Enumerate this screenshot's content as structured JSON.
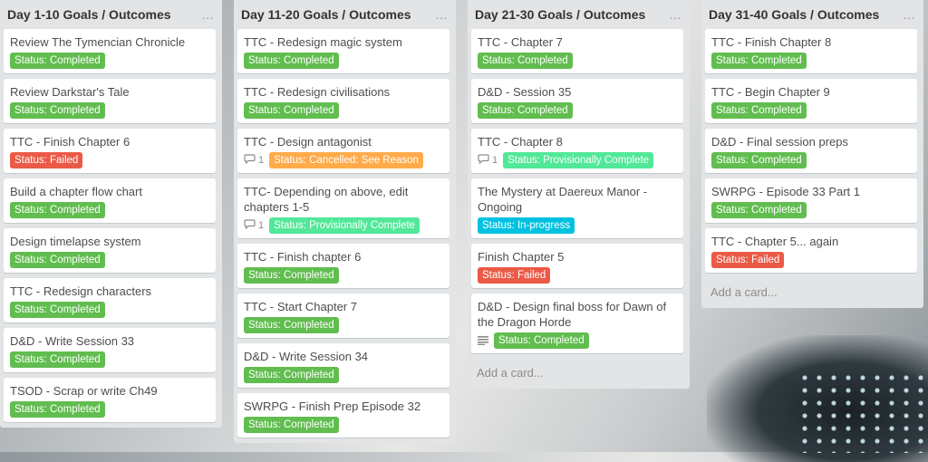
{
  "colors": {
    "completed": "#61bd4f",
    "failed": "#eb5a46",
    "cancelled": "#ffab4a",
    "provisional": "#51e898",
    "in_progress": "#00c2e0"
  },
  "lists": [
    {
      "title": "Day 1-10 Goals / Outcomes",
      "menu_icon": "ellipsis-icon",
      "cards": [
        {
          "title": "Review The Tymencian Chronicle",
          "label": "Status: Completed",
          "status": "completed"
        },
        {
          "title": "Review Darkstar's Tale",
          "label": "Status: Completed",
          "status": "completed"
        },
        {
          "title": "TTC - Finish Chapter 6",
          "label": "Status: Failed",
          "status": "failed"
        },
        {
          "title": "Build a chapter flow chart",
          "label": "Status: Completed",
          "status": "completed"
        },
        {
          "title": "Design timelapse system",
          "label": "Status: Completed",
          "status": "completed"
        },
        {
          "title": "TTC - Redesign characters",
          "label": "Status: Completed",
          "status": "completed"
        },
        {
          "title": "D&D - Write Session 33",
          "label": "Status: Completed",
          "status": "completed"
        },
        {
          "title": "TSOD - Scrap or write Ch49",
          "label": "Status: Completed",
          "status": "completed"
        }
      ]
    },
    {
      "title": "Day 11-20 Goals / Outcomes",
      "menu_icon": "ellipsis-icon",
      "cards": [
        {
          "title": "TTC - Redesign magic system",
          "label": "Status: Completed",
          "status": "completed"
        },
        {
          "title": "TTC - Redesign civilisations",
          "label": "Status: Completed",
          "status": "completed"
        },
        {
          "title": "TTC - Design antagonist",
          "comments": "1",
          "label": "Status: Cancelled: See Reason",
          "status": "cancelled"
        },
        {
          "title": "TTC- Depending on above, edit chapters 1-5",
          "comments": "1",
          "label": "Status: Provisionally Complete",
          "status": "provisional"
        },
        {
          "title": "TTC - Finish chapter 6",
          "label": "Status: Completed",
          "status": "completed"
        },
        {
          "title": "TTC - Start Chapter 7",
          "label": "Status: Completed",
          "status": "completed"
        },
        {
          "title": "D&D - Write Session 34",
          "label": "Status: Completed",
          "status": "completed"
        },
        {
          "title": "SWRPG - Finish Prep Episode 32",
          "label": "Status: Completed",
          "status": "completed"
        }
      ]
    },
    {
      "title": "Day 21-30 Goals / Outcomes",
      "menu_icon": "ellipsis-icon",
      "cards": [
        {
          "title": "TTC - Chapter 7",
          "label": "Status: Completed",
          "status": "completed"
        },
        {
          "title": "D&D - Session 35",
          "label": "Status: Completed",
          "status": "completed"
        },
        {
          "title": "TTC - Chapter 8",
          "comments": "1",
          "label": "Status: Provisionally Complete",
          "status": "provisional"
        },
        {
          "title": "The Mystery at Daereux Manor - Ongoing",
          "label": "Status: In-progress",
          "status": "in_progress"
        },
        {
          "title": "Finish Chapter 5",
          "label": "Status: Failed",
          "status": "failed"
        },
        {
          "title": "D&D - Design final boss for Dawn of the Dragon Horde",
          "description_icon": "description-icon",
          "label": "Status: Completed",
          "status": "completed"
        }
      ],
      "add_card": "Add a card..."
    },
    {
      "title": "Day 31-40 Goals / Outcomes",
      "menu_icon": "ellipsis-icon",
      "cards": [
        {
          "title": "TTC - Finish Chapter 8",
          "label": "Status: Completed",
          "status": "completed"
        },
        {
          "title": "TTC - Begin Chapter 9",
          "label": "Status: Completed",
          "status": "completed"
        },
        {
          "title": "D&D - Final session preps",
          "label": "Status: Completed",
          "status": "completed"
        },
        {
          "title": "SWRPG - Episode 33 Part 1",
          "label": "Status: Completed",
          "status": "completed"
        },
        {
          "title": "TTC - Chapter 5... again",
          "label": "Status: Failed",
          "status": "failed"
        }
      ],
      "add_card": "Add a card..."
    }
  ]
}
